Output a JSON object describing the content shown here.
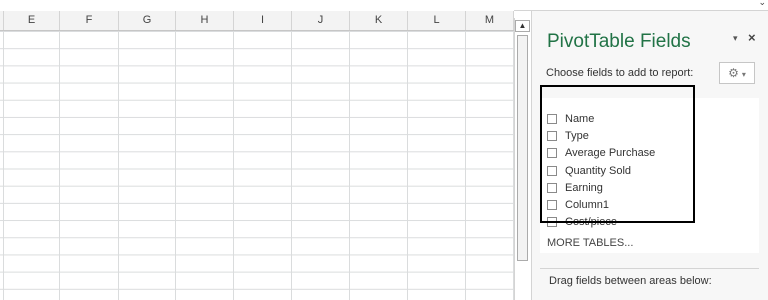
{
  "columns": [
    "E",
    "F",
    "G",
    "H",
    "I",
    "J",
    "K",
    "L",
    "M"
  ],
  "top_dropdown_icon": "chevron-down-icon",
  "scrollbar": {
    "up_arrow": "▲"
  },
  "pivot_pane": {
    "title": "PivotTable Fields",
    "menu_icon": "▾",
    "close_icon": "×",
    "choose_label": "Choose fields to add to report:",
    "settings_icon": "⚙",
    "settings_caret": "▾",
    "fields": [
      {
        "label": "Name",
        "checked": false
      },
      {
        "label": "Type",
        "checked": false
      },
      {
        "label": "Average Purchase",
        "checked": false
      },
      {
        "label": "Quantity Sold",
        "checked": false
      },
      {
        "label": "Earning",
        "checked": false
      },
      {
        "label": "Column1",
        "checked": false
      },
      {
        "label": "Cost/piece",
        "checked": false
      }
    ],
    "more_tables": "MORE TABLES...",
    "drag_label": "Drag fields between areas below:"
  },
  "colors": {
    "title_green": "#217346",
    "highlight_border": "#000000",
    "gridline": "#dadcdd"
  }
}
